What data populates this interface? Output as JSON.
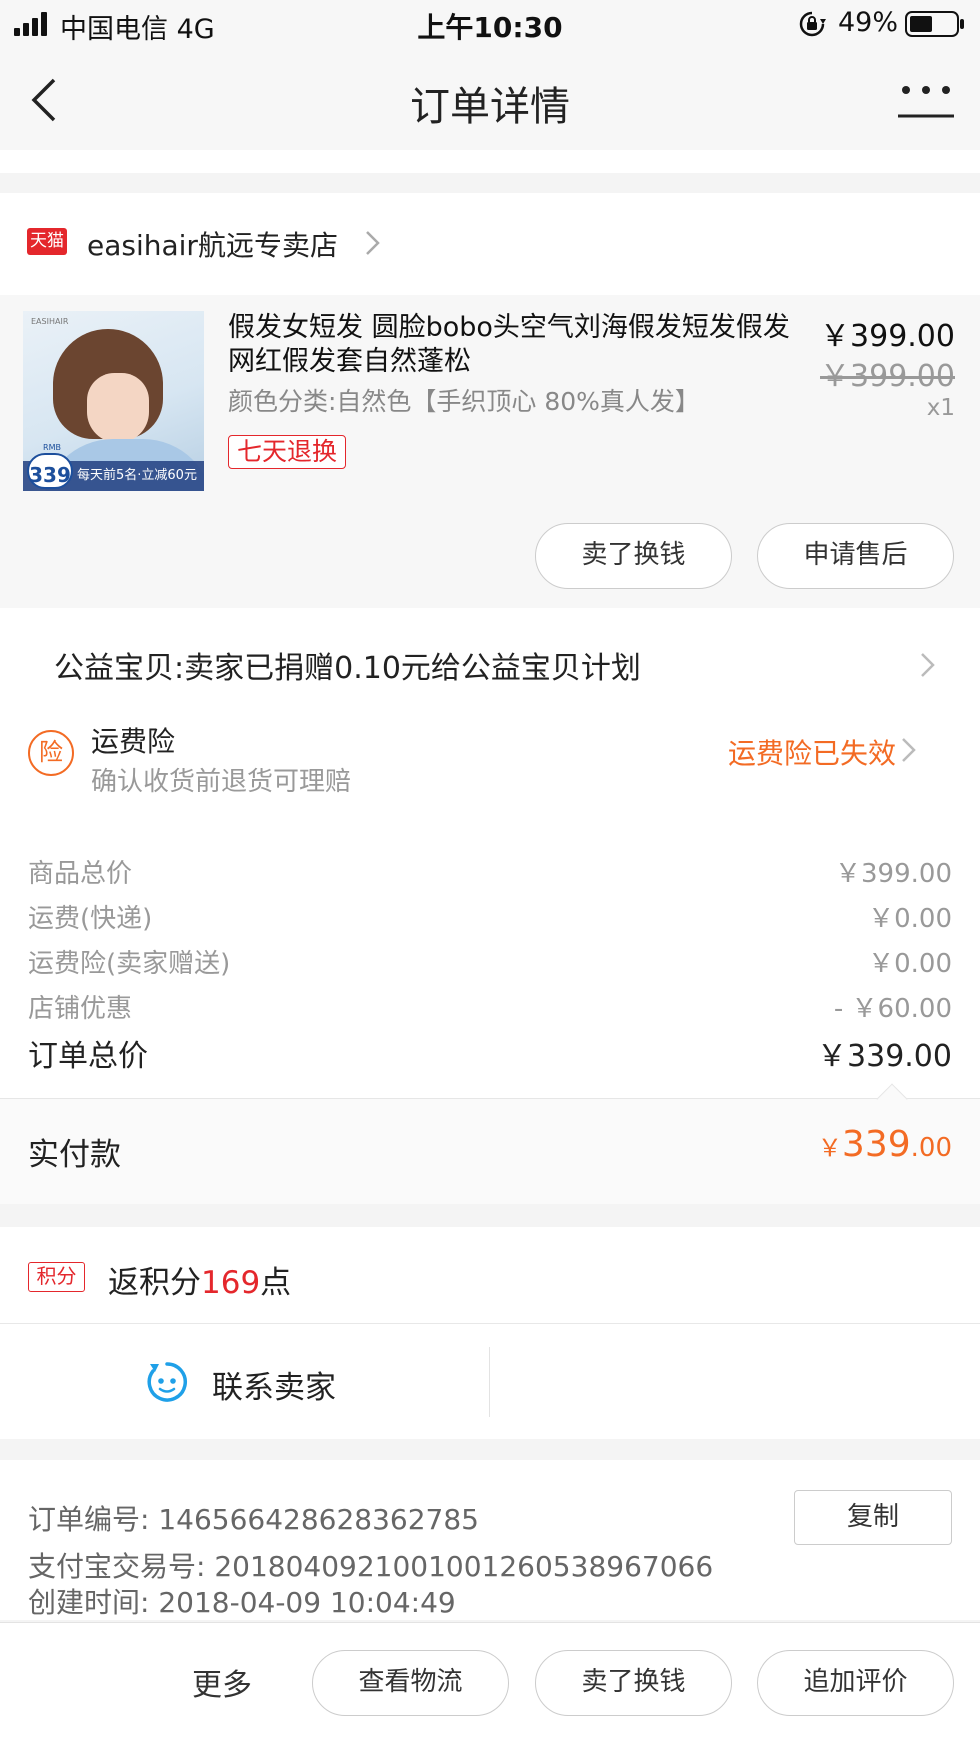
{
  "status_bar": {
    "carrier": "中国电信  4G",
    "time": "上午10:30",
    "battery": "49%"
  },
  "nav": {
    "title": "订单详情"
  },
  "shop": {
    "logo_text": "天猫",
    "name": "easihair航远专卖店"
  },
  "item": {
    "title": "假发女短发 圆脸bobo头空气刘海假发短发假发网红假发套自然蓬松",
    "sku": "颜色分类:自然色【手织顶心 80%真人发】",
    "tag": "七天退换",
    "price": "￥399.00",
    "original_price": "￥399.00",
    "quantity": "x1",
    "thumb_brand": "EASIHAIR",
    "thumb_badge_small": "RMB",
    "thumb_badge": "339",
    "thumb_bar": "每天前5名·立减60元",
    "buttons": [
      "卖了换钱",
      "申请售后"
    ]
  },
  "charity": {
    "text": "公益宝贝:卖家已捐赠0.10元给公益宝贝计划"
  },
  "insurance": {
    "icon_text": "险",
    "title": "运费险",
    "subtitle": "确认收货前退货可理赔",
    "status": "运费险已失效"
  },
  "costs": {
    "rows": [
      {
        "label": "商品总价",
        "value": "￥399.00"
      },
      {
        "label": "运费(快递)",
        "value": "￥0.00"
      },
      {
        "label": "运费险(卖家赠送)",
        "value": "￥0.00"
      },
      {
        "label": "店铺优惠",
        "value": "- ￥60.00"
      }
    ],
    "total_label": "订单总价",
    "total_value": "￥339.00"
  },
  "paid": {
    "label": "实付款",
    "currency": "￥",
    "integer": "339",
    "decimal": ".00"
  },
  "points": {
    "badge": "积分",
    "prefix": "返积分",
    "number": "169",
    "suffix": "点"
  },
  "contact": {
    "label": "联系卖家"
  },
  "order_info": {
    "order_no": "订单编号:  146566428628362785",
    "alipay_no": "支付宝交易号:  2018040921001001260538967066",
    "created": "创建时间:  2018-04-09 10:04:49",
    "copy_label": "复制"
  },
  "bottom_bar": {
    "more": "更多",
    "buttons": [
      "查看物流",
      "卖了换钱",
      "追加评价"
    ]
  },
  "colors": {
    "accent_orange": "#f36b24",
    "tmall_red": "#e4272c",
    "contact_blue": "#1fa0e8"
  }
}
